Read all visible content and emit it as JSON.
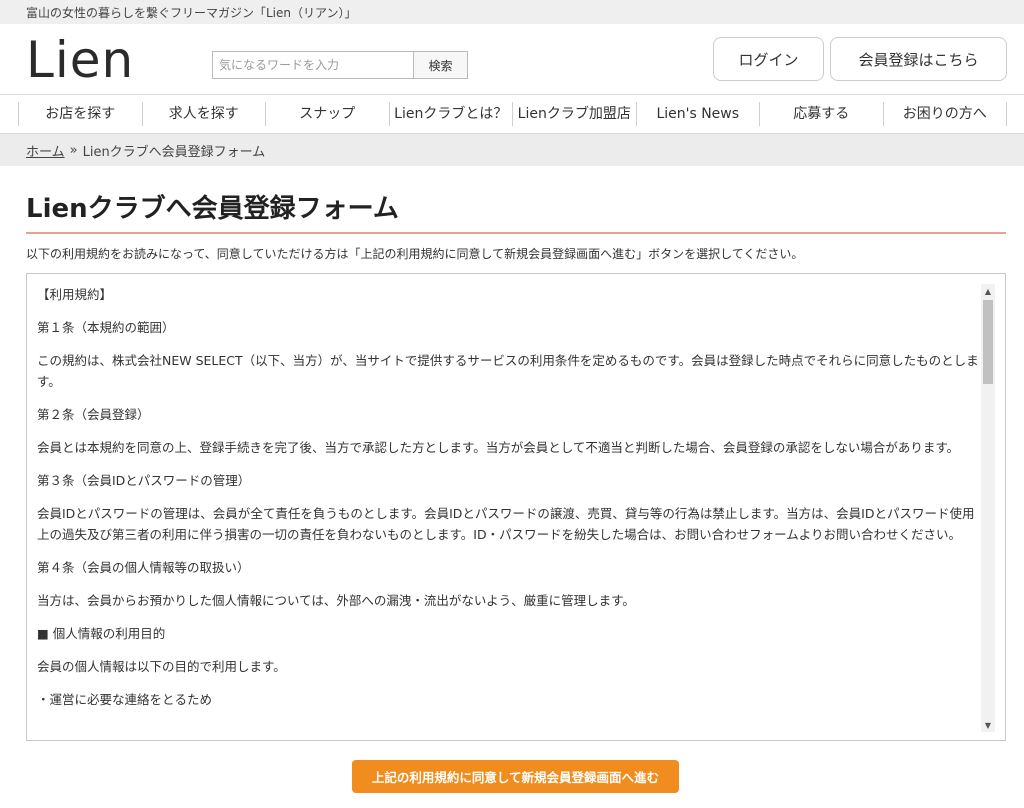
{
  "topbar": {
    "tagline": "富山の女性の暮らしを繋ぐフリーマガジン「Lien（リアン）」"
  },
  "header": {
    "logo": "Lien",
    "search_placeholder": "気になるワードを入力",
    "search_button": "検索",
    "login_label": "ログイン",
    "register_label": "会員登録はこちら"
  },
  "nav": {
    "items": [
      {
        "label": "お店を探す"
      },
      {
        "label": "求人を探す"
      },
      {
        "label": "スナップ"
      },
      {
        "label": "Lienクラブとは？"
      },
      {
        "label": "Lienクラブ加盟店"
      },
      {
        "label": "Lien's News"
      },
      {
        "label": "応募する"
      },
      {
        "label": "お困りの方へ"
      }
    ]
  },
  "breadcrumb": {
    "home": "ホーム",
    "separator": "»",
    "current": "Lienクラブへ会員登録フォーム"
  },
  "page": {
    "title": "Lienクラブへ会員登録フォーム",
    "intro": "以下の利用規約をお読みになって、同意していただける方は「上記の利用規約に同意して新規会員登録画面へ進む」ボタンを選択してください。"
  },
  "terms": {
    "heading": "【利用規約】",
    "paragraphs": [
      "第１条（本規約の範囲）",
      "この規約は、株式会社NEW SELECT（以下、当方）が、当サイトで提供するサービスの利用条件を定めるものです。会員は登録した時点でそれらに同意したものとします。",
      "第２条（会員登録）",
      "会員とは本規約を同意の上、登録手続きを完了後、当方で承認した方とします。当方が会員として不適当と判断した場合、会員登録の承認をしない場合があります。",
      "第３条（会員IDとパスワードの管理）",
      "会員IDとパスワードの管理は、会員が全て責任を負うものとします。会員IDとパスワードの譲渡、売買、貸与等の行為は禁止します。当方は、会員IDとパスワード使用上の過失及び第三者の利用に伴う損害の一切の責任を負わないものとします。ID・パスワードを紛失した場合は、お問い合わせフォームよりお問い合わせください。",
      "第４条（会員の個人情報等の取扱い）",
      "当方は、会員からお預かりした個人情報については、外部への漏洩・流出がないよう、厳重に管理します。",
      "■ 個人情報の利用目的",
      "会員の個人情報は以下の目的で利用します。",
      "・運営に必要な連絡をとるため"
    ],
    "scroll_up": "▲",
    "scroll_down": "▼"
  },
  "agree_button": "上記の利用規約に同意して新規会員登録画面へ進む"
}
